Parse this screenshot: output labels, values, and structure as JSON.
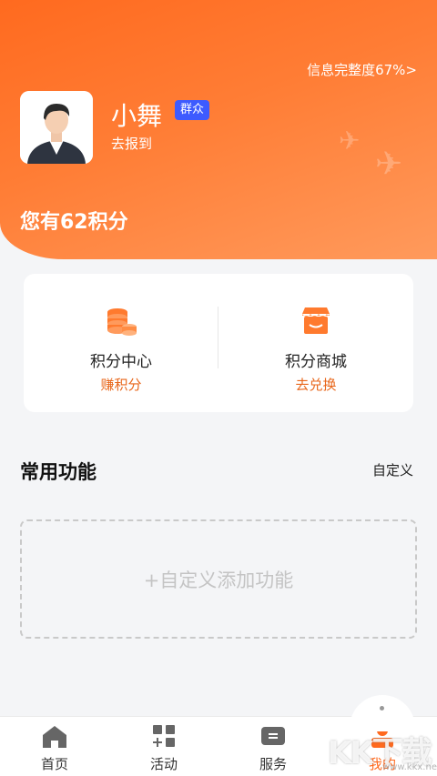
{
  "header": {
    "info_complete": "信息完整度67%>",
    "username": "小舞",
    "role_badge": "群众",
    "checkin": "去报到",
    "points_text": "您有62积分"
  },
  "points_card": {
    "left": {
      "title": "积分中心",
      "sub": "赚积分",
      "icon": "coins-stack-icon"
    },
    "right": {
      "title": "积分商城",
      "sub": "去兑换",
      "icon": "shop-icon"
    }
  },
  "common": {
    "title": "常用功能",
    "customize": "自定义",
    "add_placeholder": "+自定义添加功能"
  },
  "tabbar": {
    "items": [
      {
        "label": "首页",
        "icon": "home-icon"
      },
      {
        "label": "活动",
        "icon": "grid-plus-icon"
      },
      {
        "label": "服务",
        "icon": "message-icon"
      },
      {
        "label": "我的",
        "icon": "user-icon",
        "active": true
      }
    ]
  },
  "watermark": {
    "text": "KK下载",
    "sub": "www.kkx.net"
  },
  "colors": {
    "accent": "#ff6a1f",
    "badge": "#3d5bff",
    "sub_text": "#e8661a"
  }
}
